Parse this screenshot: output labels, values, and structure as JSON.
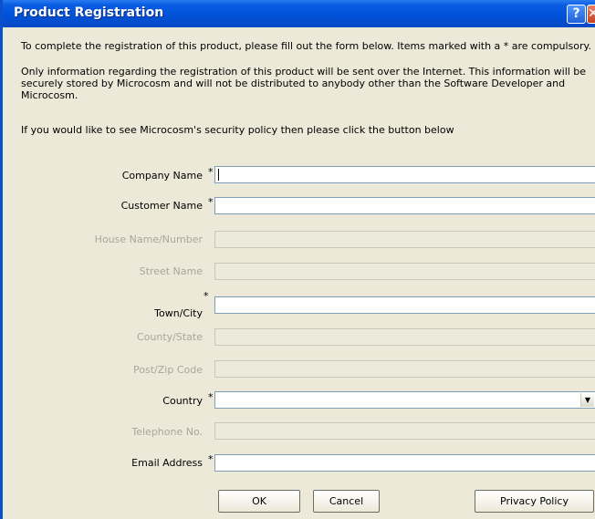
{
  "window": {
    "title": "Product Registration",
    "help_glyph": "?",
    "close_glyph": "✕"
  },
  "intro": {
    "line1": "To complete the registration of this product, please fill out the form below. Items marked with a * are compulsory.",
    "line2": "Only information regarding the registration of this product will be sent over the Internet. This information will be securely stored by Microcosm and will not be distributed to anybody other than the Software Developer and Microcosm.",
    "line3": "If you would like to see Microcosm's security policy then please click the button below"
  },
  "fields": [
    {
      "label": "Company Name",
      "required": true,
      "enabled": true,
      "value": ""
    },
    {
      "label": "Customer Name",
      "required": true,
      "enabled": true,
      "value": ""
    },
    {
      "label": "House Name/Number",
      "required": false,
      "enabled": false,
      "value": ""
    },
    {
      "label": "Street Name",
      "required": false,
      "enabled": false,
      "value": ""
    },
    {
      "label": "Town/City",
      "required": true,
      "enabled": true,
      "value": ""
    },
    {
      "label": "County/State",
      "required": false,
      "enabled": false,
      "value": ""
    },
    {
      "label": "Post/Zip Code",
      "required": false,
      "enabled": false,
      "value": ""
    },
    {
      "label": "Country",
      "required": true,
      "enabled": true,
      "value": "",
      "type": "dropdown"
    },
    {
      "label": "Telephone No.",
      "required": false,
      "enabled": false,
      "value": ""
    },
    {
      "label": "Email Address",
      "required": true,
      "enabled": true,
      "value": ""
    }
  ],
  "required_mark": "*",
  "dropdown_arrow": "▼",
  "buttons": {
    "ok": "OK",
    "cancel": "Cancel",
    "privacy": "Privacy Policy"
  },
  "colors": {
    "titlebar": "#0052d9",
    "dialog_bg": "#ece9d8",
    "disabled_text": "#a7a69a"
  }
}
